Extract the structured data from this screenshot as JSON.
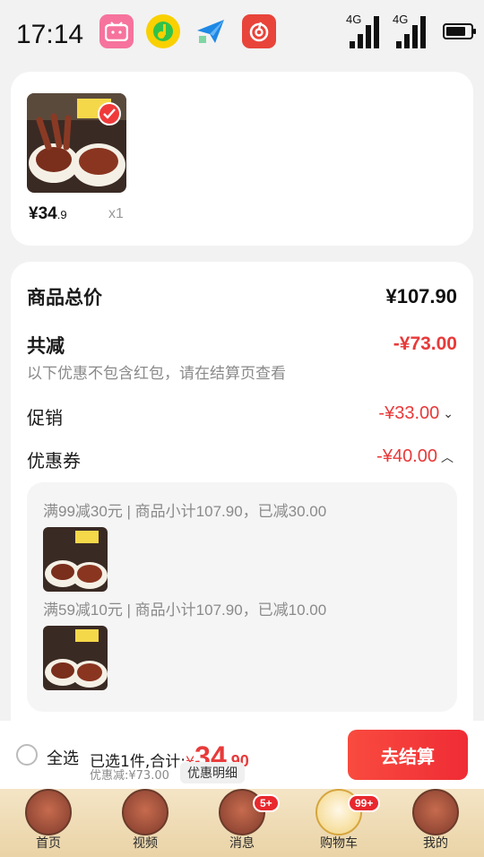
{
  "status_bar": {
    "time": "17:14",
    "signal1_label": "4G",
    "signal2_label": "4G",
    "battery_level": 0.8
  },
  "product": {
    "price_int": "¥34",
    "price_dec": ".9",
    "qty": "x1"
  },
  "summary": {
    "total_label": "商品总价",
    "total_value": "¥107.90",
    "reduce_label": "共减",
    "reduce_value": "-¥73.00",
    "note": "以下优惠不包含红包，请在结算页查看",
    "promo_label": "促销",
    "promo_value": "-¥33.00",
    "coupon_label": "优惠券",
    "coupon_value": "-¥40.00",
    "coupon_lines": [
      "满99减30元 | 商品小计107.90，已减30.00",
      "满59减10元 | 商品小计107.90，已减10.00"
    ]
  },
  "checkout": {
    "select_all": "全选",
    "selected_text": "已选1件,合计:",
    "currency": "¥",
    "total_int": "34",
    "total_dec": ".90",
    "discount": "优惠减:¥73.00",
    "detail": "优惠明细",
    "button": "去结算"
  },
  "tabs": [
    {
      "label": "首页",
      "badge": ""
    },
    {
      "label": "视频",
      "badge": ""
    },
    {
      "label": "消息",
      "badge": "5+"
    },
    {
      "label": "购物车",
      "badge": "99+"
    },
    {
      "label": "我的",
      "badge": ""
    }
  ],
  "colors": {
    "accent_red": "#e83a3a",
    "button_red": "#f23a3a",
    "tabbar_bg": "#f0dcb6"
  }
}
